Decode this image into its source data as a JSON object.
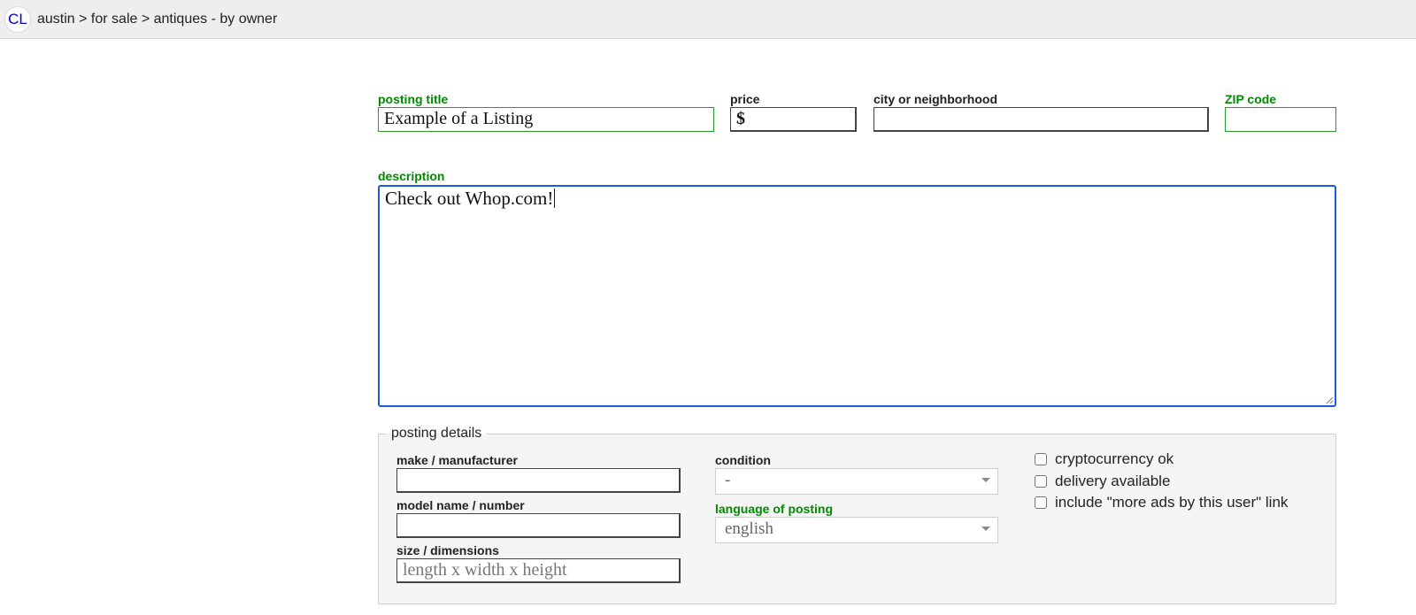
{
  "header": {
    "logo": "CL",
    "breadcrumb": "austin > for sale > antiques - by owner"
  },
  "form": {
    "posting_title": {
      "label": "posting title",
      "value": "Example of a Listing"
    },
    "price": {
      "label": "price",
      "value": "$"
    },
    "city": {
      "label": "city or neighborhood",
      "value": ""
    },
    "zip": {
      "label": "ZIP code",
      "value": ""
    },
    "description": {
      "label": "description",
      "value": "Check out Whop.com!"
    }
  },
  "details": {
    "legend": "posting details",
    "make": {
      "label": "make / manufacturer",
      "value": ""
    },
    "model": {
      "label": "model name / number",
      "value": ""
    },
    "size": {
      "label": "size / dimensions",
      "placeholder": "length x width x height"
    },
    "condition": {
      "label": "condition",
      "selected": "-"
    },
    "language": {
      "label": "language of posting",
      "selected": "english"
    },
    "checkboxes": [
      {
        "label": "cryptocurrency ok",
        "checked": false
      },
      {
        "label": "delivery available",
        "checked": false
      },
      {
        "label": "include \"more ads by this user\" link",
        "checked": false
      }
    ]
  },
  "colors": {
    "required_label": "#008a00",
    "focus_border": "#1c5ad6",
    "logo": "#0000e0"
  }
}
